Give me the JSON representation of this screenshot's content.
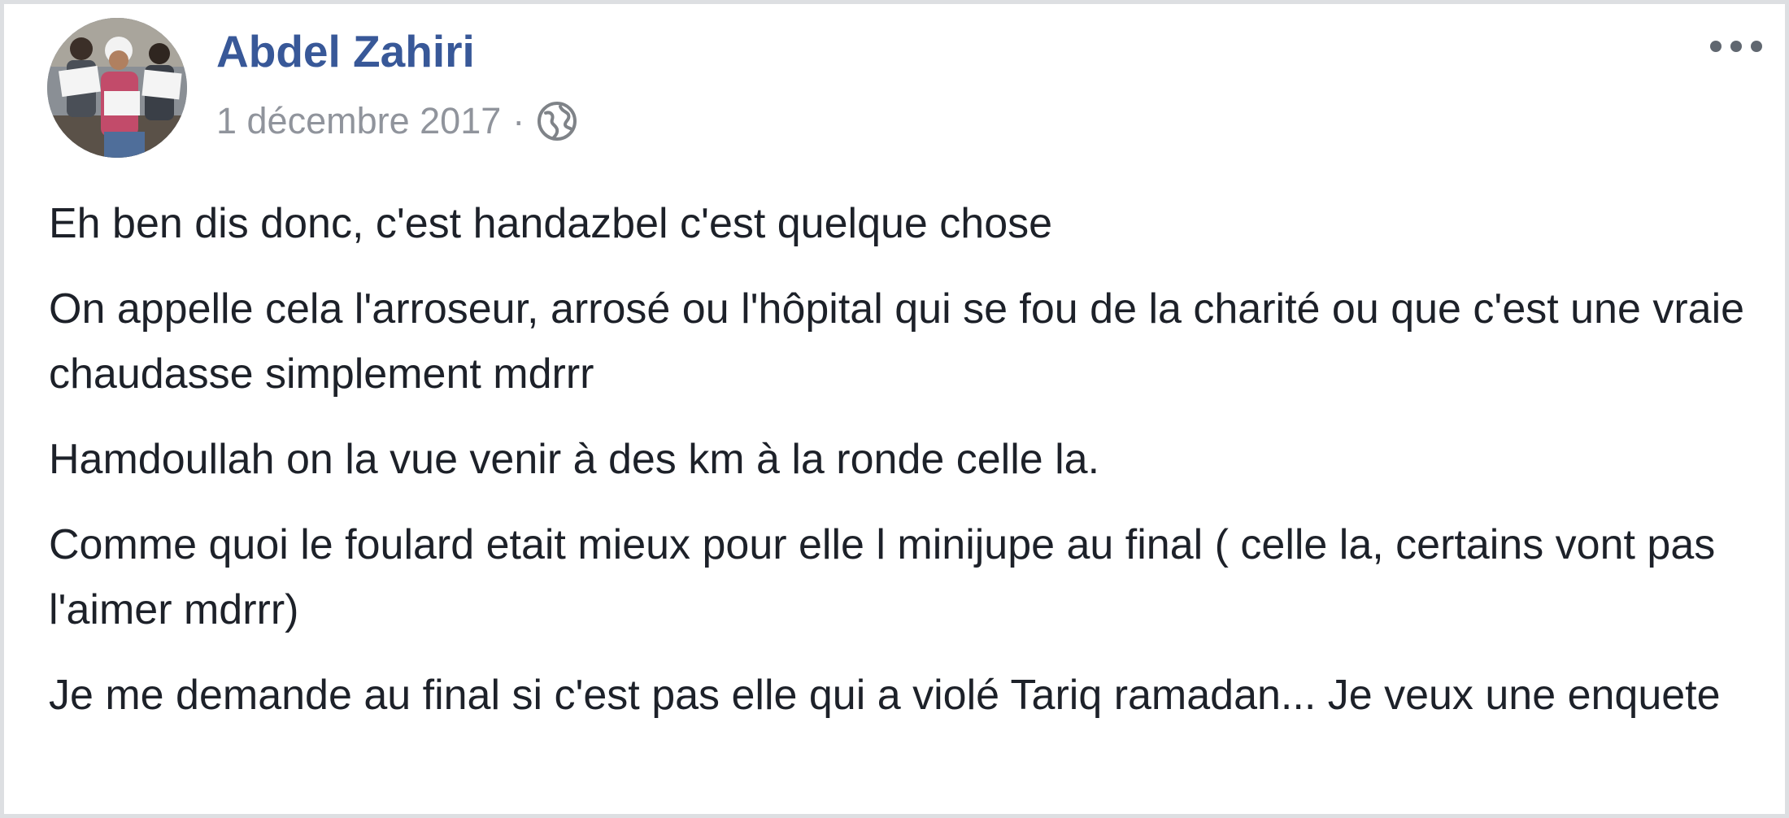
{
  "post": {
    "author": "Abdel Zahiri",
    "date": "1 décembre 2017",
    "separator": "·",
    "audience_icon": "globe-icon",
    "menu_icon": "more-options-icon",
    "paragraphs": [
      "Eh ben dis donc, c'est handazbel c'est quelque chose",
      "On appelle cela l'arroseur, arrosé ou l'hôpital qui se fou de la charité ou que c'est une vraie chaudasse simplement mdrrr",
      "Hamdoullah on la vue venir à des km à la ronde celle la.",
      "Comme quoi le foulard etait mieux pour elle l minijupe au final ( celle la, certains vont pas l'aimer mdrrr)",
      "Je me demande au final si c'est pas elle qui a violé Tariq ramadan... Je veux une enquete"
    ]
  },
  "colors": {
    "author_link": "#385898",
    "meta_text": "#90949c",
    "body_text": "#1d2129",
    "border": "#dddfe2"
  }
}
